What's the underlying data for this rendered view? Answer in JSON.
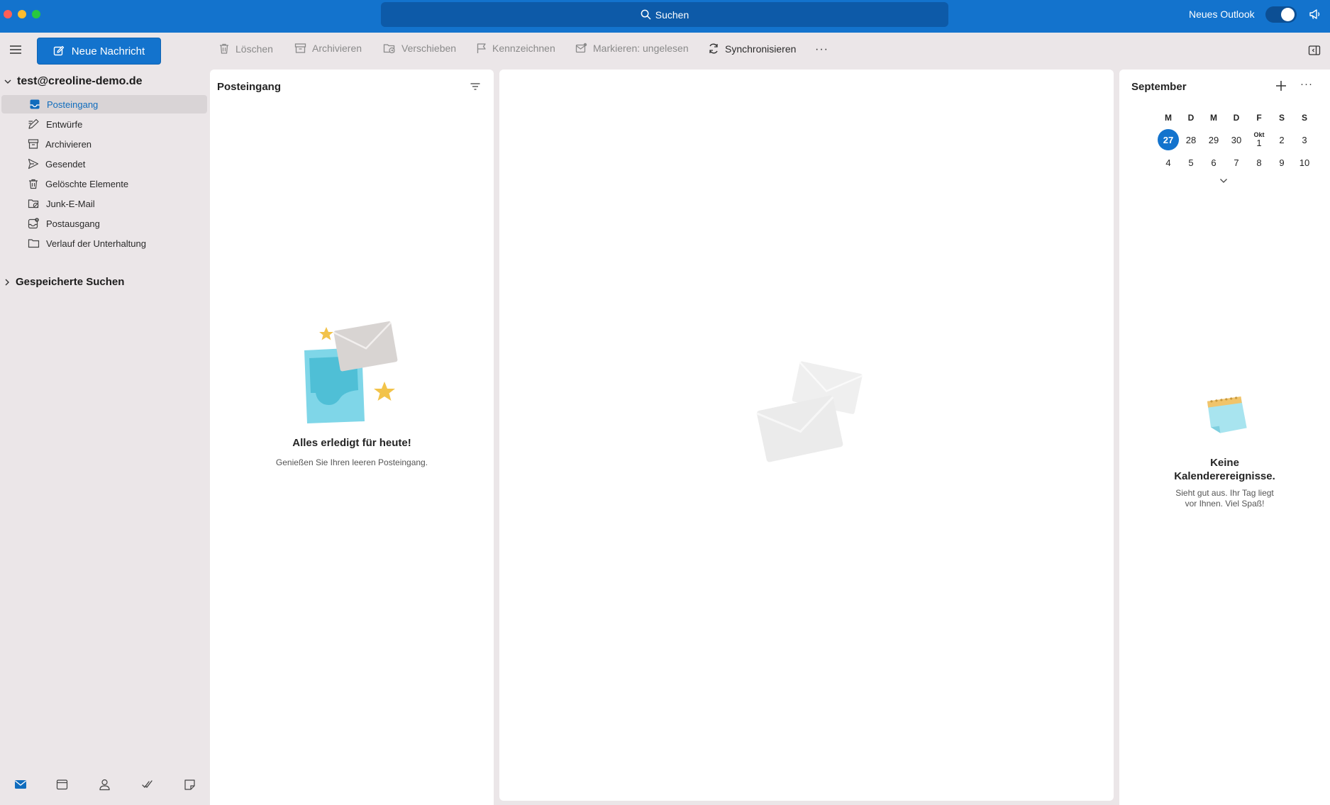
{
  "titlebar": {
    "search_label": "Suchen",
    "neues_outlook_label": "Neues Outlook",
    "toggle_on": true
  },
  "toolbar": {
    "new_message": "Neue Nachricht",
    "delete": "Löschen",
    "archive": "Archivieren",
    "move": "Verschieben",
    "flag": "Kennzeichnen",
    "mark_unread": "Markieren: ungelesen",
    "sync": "Synchronisieren",
    "more": "···"
  },
  "sidebar": {
    "account": "test@creoline-demo.de",
    "folders": [
      {
        "label": "Posteingang",
        "icon": "inbox-icon",
        "active": true
      },
      {
        "label": "Entwürfe",
        "icon": "drafts-icon"
      },
      {
        "label": "Archivieren",
        "icon": "archive-icon"
      },
      {
        "label": "Gesendet",
        "icon": "sent-icon"
      },
      {
        "label": "Gelöschte Elemente",
        "icon": "trash-icon"
      },
      {
        "label": "Junk-E-Mail",
        "icon": "junk-icon"
      },
      {
        "label": "Postausgang",
        "icon": "outbox-icon"
      },
      {
        "label": "Verlauf der Unterhaltung",
        "icon": "folder-icon"
      }
    ],
    "saved_searches": "Gespeicherte Suchen",
    "bottom_nav": [
      "mail-icon",
      "calendar-icon",
      "people-icon",
      "todo-icon",
      "notes-icon"
    ]
  },
  "message_list": {
    "title": "Posteingang",
    "empty_title": "Alles erledigt für heute!",
    "empty_subtitle": "Genießen Sie Ihren leeren Posteingang."
  },
  "calendar": {
    "month": "September",
    "weekdays": [
      "M",
      "D",
      "M",
      "D",
      "F",
      "S",
      "S"
    ],
    "week1": [
      "27",
      "28",
      "29",
      "30",
      "1",
      "2",
      "3"
    ],
    "week1_month_marker": "Okt",
    "week2": [
      "4",
      "5",
      "6",
      "7",
      "8",
      "9",
      "10"
    ],
    "today": "27",
    "empty_title": "Keine Kalenderereignisse.",
    "empty_subtitle": "Sieht gut aus. Ihr Tag liegt vor Ihnen. Viel Spaß!"
  },
  "colors": {
    "accent": "#1373cd",
    "sidebar_bg": "#ebe6e8"
  }
}
